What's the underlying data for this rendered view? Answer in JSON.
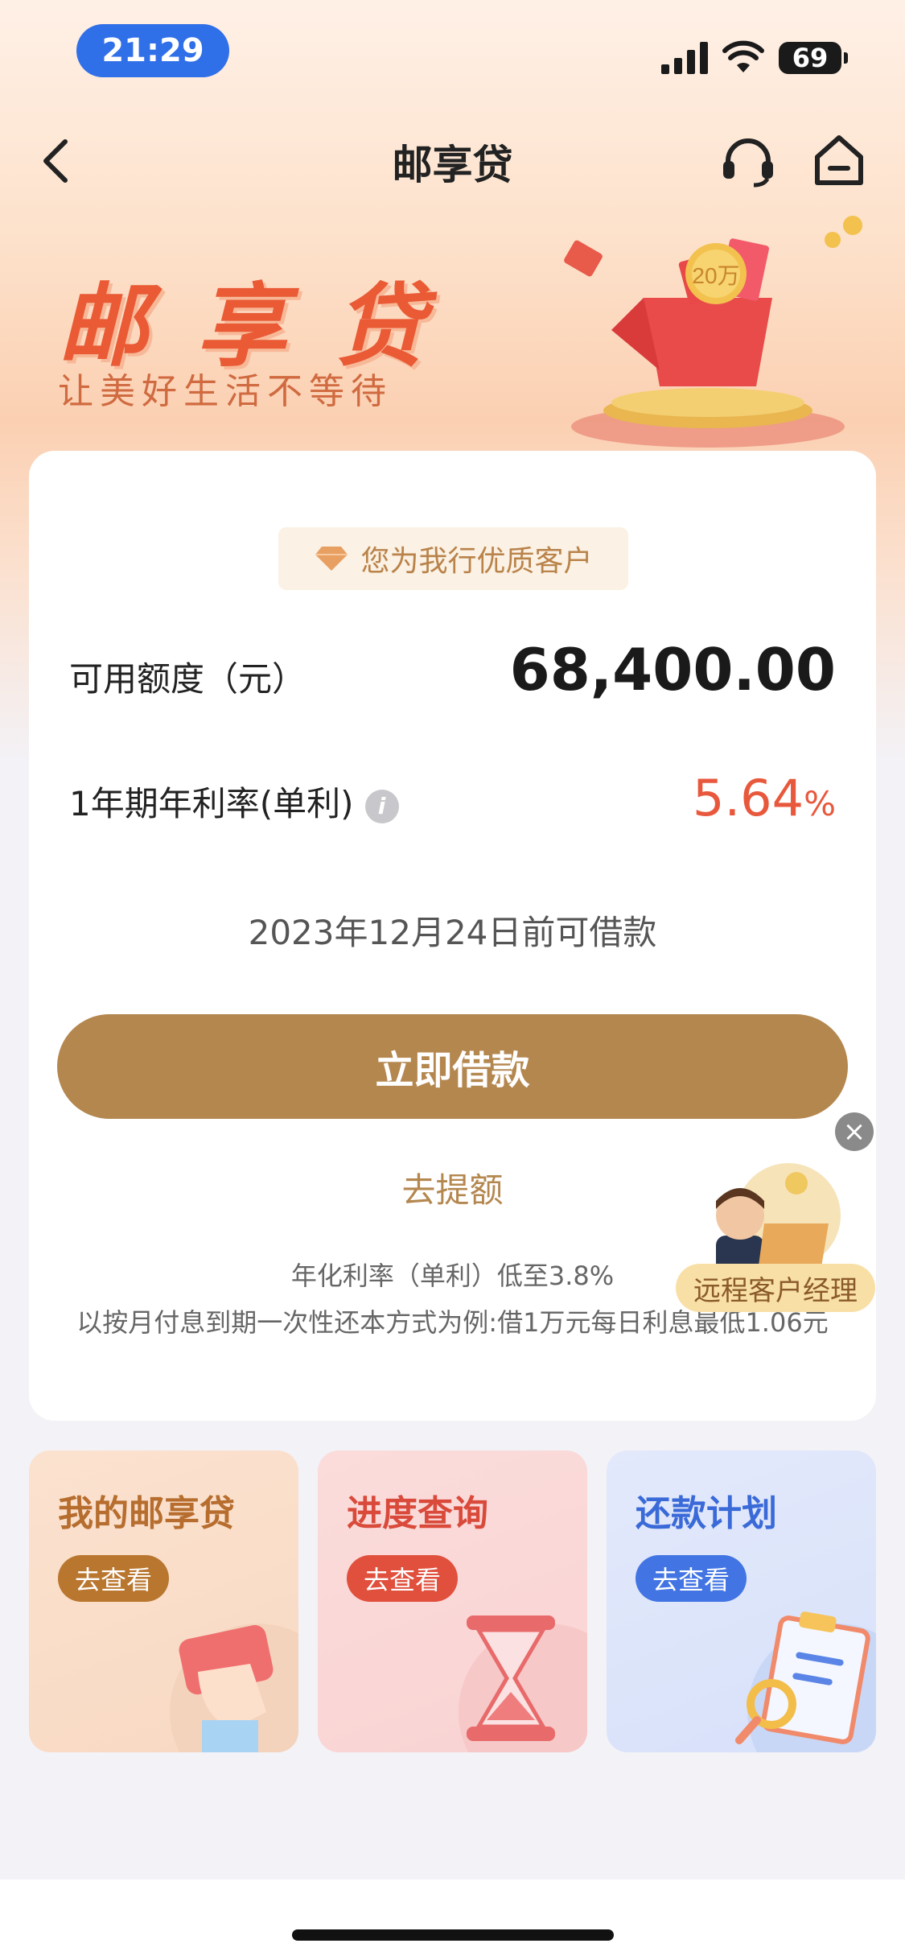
{
  "status_bar": {
    "time": "21:29",
    "battery": "69"
  },
  "nav": {
    "title": "邮享贷"
  },
  "banner": {
    "title": "邮享贷",
    "subtitle": "让美好生活不等待",
    "gift_text": "20万"
  },
  "card": {
    "badge": "您为我行优质客户",
    "available_label": "可用额度（元）",
    "available_amount": "68,400.00",
    "rate_label": "1年期年利率(单利)",
    "rate_value": "5.64",
    "rate_unit": "%",
    "deadline": "2023年12月24日前可借款",
    "borrow_button": "立即借款",
    "raise_link": "去提额",
    "fine_print_1": "年化利率（单利）低至3.8%",
    "fine_print_2": "以按月付息到期一次性还本方式为例:借1万元每日利息最低1.06元"
  },
  "floating": {
    "manager_label": "远程客户经理"
  },
  "tiles": [
    {
      "title": "我的邮享贷",
      "button": "去查看",
      "color": "#b66d2e",
      "btn_color": "#b9762f"
    },
    {
      "title": "进度查询",
      "button": "去查看",
      "color": "#d94a3a",
      "btn_color": "#e0503d"
    },
    {
      "title": "还款计划",
      "button": "去查看",
      "color": "#3a6ad8",
      "btn_color": "#4275e3"
    }
  ]
}
